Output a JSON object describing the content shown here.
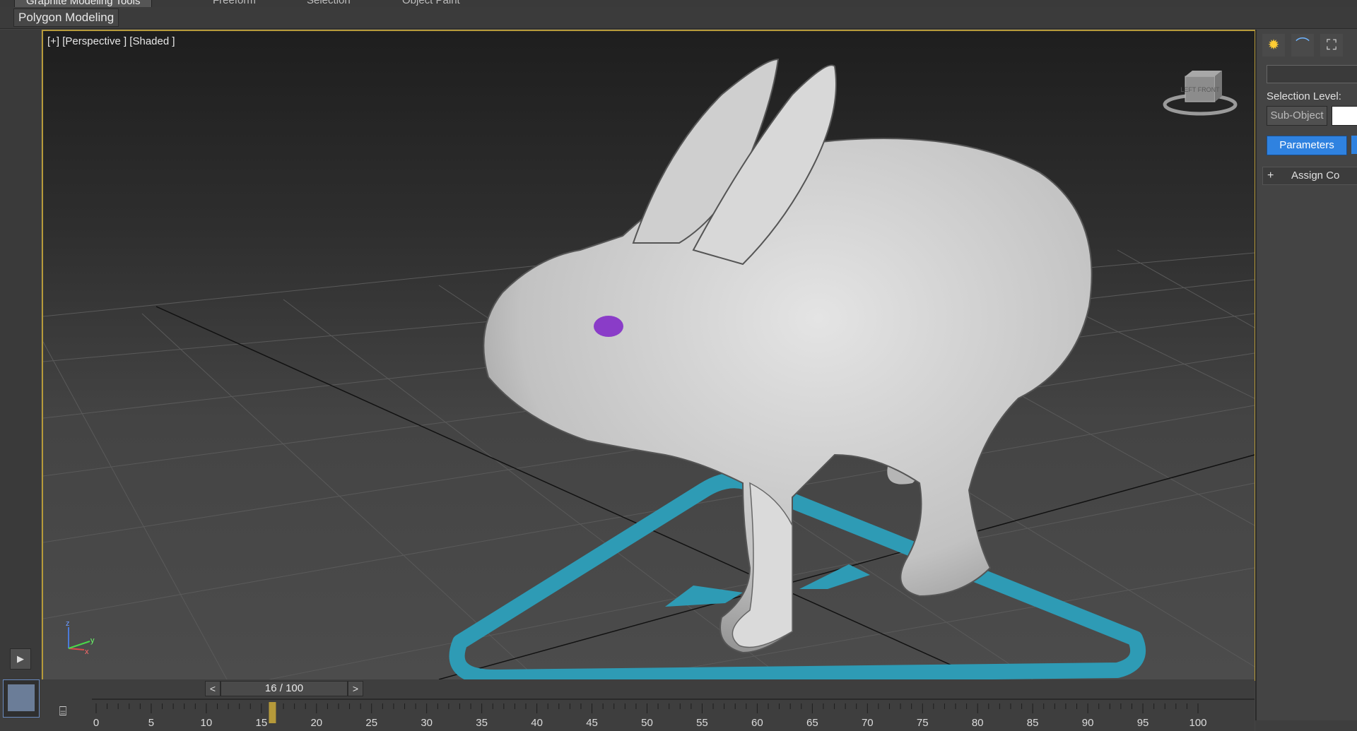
{
  "ribbon": {
    "tabs": [
      "Graphite Modeling Tools",
      "Freeform",
      "Selection",
      "Object Paint"
    ],
    "active_tab": "Graphite Modeling Tools",
    "panel_button": "Polygon Modeling"
  },
  "viewport": {
    "label": "[+] [Perspective ] [Shaded ]",
    "viewcube_faces": "LEFT FRONT",
    "axis_labels": {
      "z": "z",
      "x": "x",
      "y": "y"
    }
  },
  "command_panel": {
    "selection_level_label": "Selection Level:",
    "sub_object_label": "Sub-Object",
    "parameters_label": "Parameters",
    "rollout_plus": "+",
    "rollout_label": "Assign Co"
  },
  "timeline": {
    "prev": "<",
    "next": ">",
    "frame_display": "16 / 100",
    "current_frame": 16,
    "total_frames": 100,
    "tick_labels": [
      "0",
      "5",
      "10",
      "15",
      "20",
      "25",
      "30",
      "35",
      "40",
      "45",
      "50",
      "55",
      "60",
      "65",
      "70",
      "75",
      "80",
      "85",
      "90",
      "95",
      "100"
    ]
  },
  "colors": {
    "viewport_border": "#b69a3a",
    "param_button": "#2f82e0",
    "eye": "#8a3cc8",
    "ring": "#2e9bb5"
  }
}
